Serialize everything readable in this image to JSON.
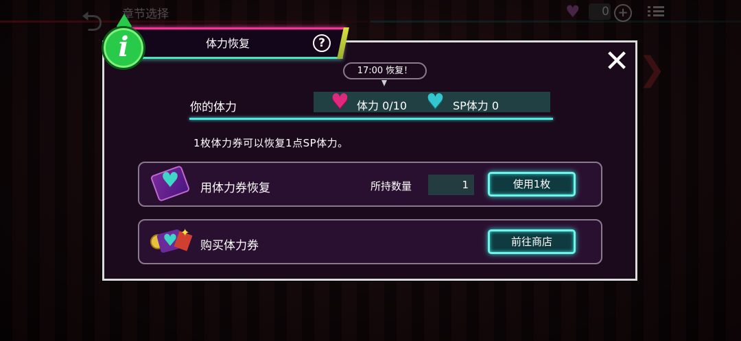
{
  "background": {
    "screen_title": "章节选择",
    "currency_value": "0"
  },
  "dialog": {
    "title": "体力恢复",
    "help_symbol": "?",
    "info_symbol": "i",
    "close_symbol": "✕",
    "recover_time": "17:00 恢复！",
    "stamina_label": "你的体力",
    "stamina_value": "体力 0/10",
    "sp_stamina_value": "SP体力 0",
    "info_text": "1枚体力券可以恢复1点SP体力。",
    "use_option": {
      "label": "用体力券恢复",
      "held_label": "所持数量",
      "held_quantity": "1",
      "button": "使用1枚"
    },
    "buy_option": {
      "label": "购买体力券",
      "button": "前往商店"
    }
  },
  "colors": {
    "accent_cyan": "#4fe8e2",
    "accent_pink": "#ff2f9a",
    "stamina_heart": "#e0287f",
    "sp_heart": "#33c6cf",
    "info_badge": "#29c94a"
  }
}
